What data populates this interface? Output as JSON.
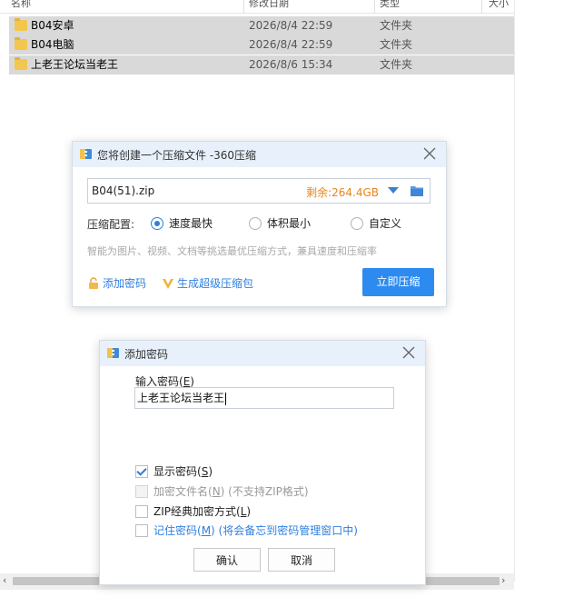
{
  "explorer": {
    "columns": {
      "name": "名称",
      "date": "修改日期",
      "type": "类型",
      "size": "大小"
    },
    "files": [
      {
        "name": "B04安卓",
        "date": "2026/8/4 22:59",
        "type": "文件夹"
      },
      {
        "name": "B04电脑",
        "date": "2026/8/4 22:59",
        "type": "文件夹"
      },
      {
        "name": "上老王论坛当老王",
        "date": "2026/8/6 15:34",
        "type": "文件夹"
      }
    ],
    "scroll_left": "‹",
    "scroll_right": "›"
  },
  "zip_dialog": {
    "title": "您将创建一个压缩文件 -360压缩",
    "filename": "B04(51).zip",
    "remaining": "剩余:264.4GB",
    "config_label": "压缩配置:",
    "options": [
      "速度最快",
      "体积最小",
      "自定义"
    ],
    "selected_option": "速度最快",
    "hint": "智能为图片、视频、文档等挑选最优压缩方式，兼具速度和压缩率",
    "add_password": "添加密码",
    "super_compress": "生成超级压缩包",
    "compress_now": "立即压缩",
    "accent_color": "#2d8bf0",
    "remain_color": "#e8851a"
  },
  "password_dialog": {
    "title": "添加密码",
    "input_label": "输入密码(",
    "input_label_key": "E",
    "input_label_end": ")",
    "password_value": "上老王论坛当老王",
    "checkboxes": {
      "show_password": {
        "text": "显示密码(",
        "key": "S",
        "end": ")",
        "checked": true
      },
      "encrypt_names": {
        "text": "加密文件名(",
        "key": "N",
        "end": ")",
        "note": " (不支持ZIP格式)",
        "disabled": true
      },
      "zip_classic": {
        "text": "ZIP经典加密方式(",
        "key": "L",
        "end": ")",
        "checked": false
      },
      "remember": {
        "text": "记住密码(",
        "key": "M",
        "end": ")",
        "note": " (将会备忘到密码管理窗口中)",
        "checked": false
      }
    },
    "ok": "确认",
    "cancel": "取消"
  }
}
